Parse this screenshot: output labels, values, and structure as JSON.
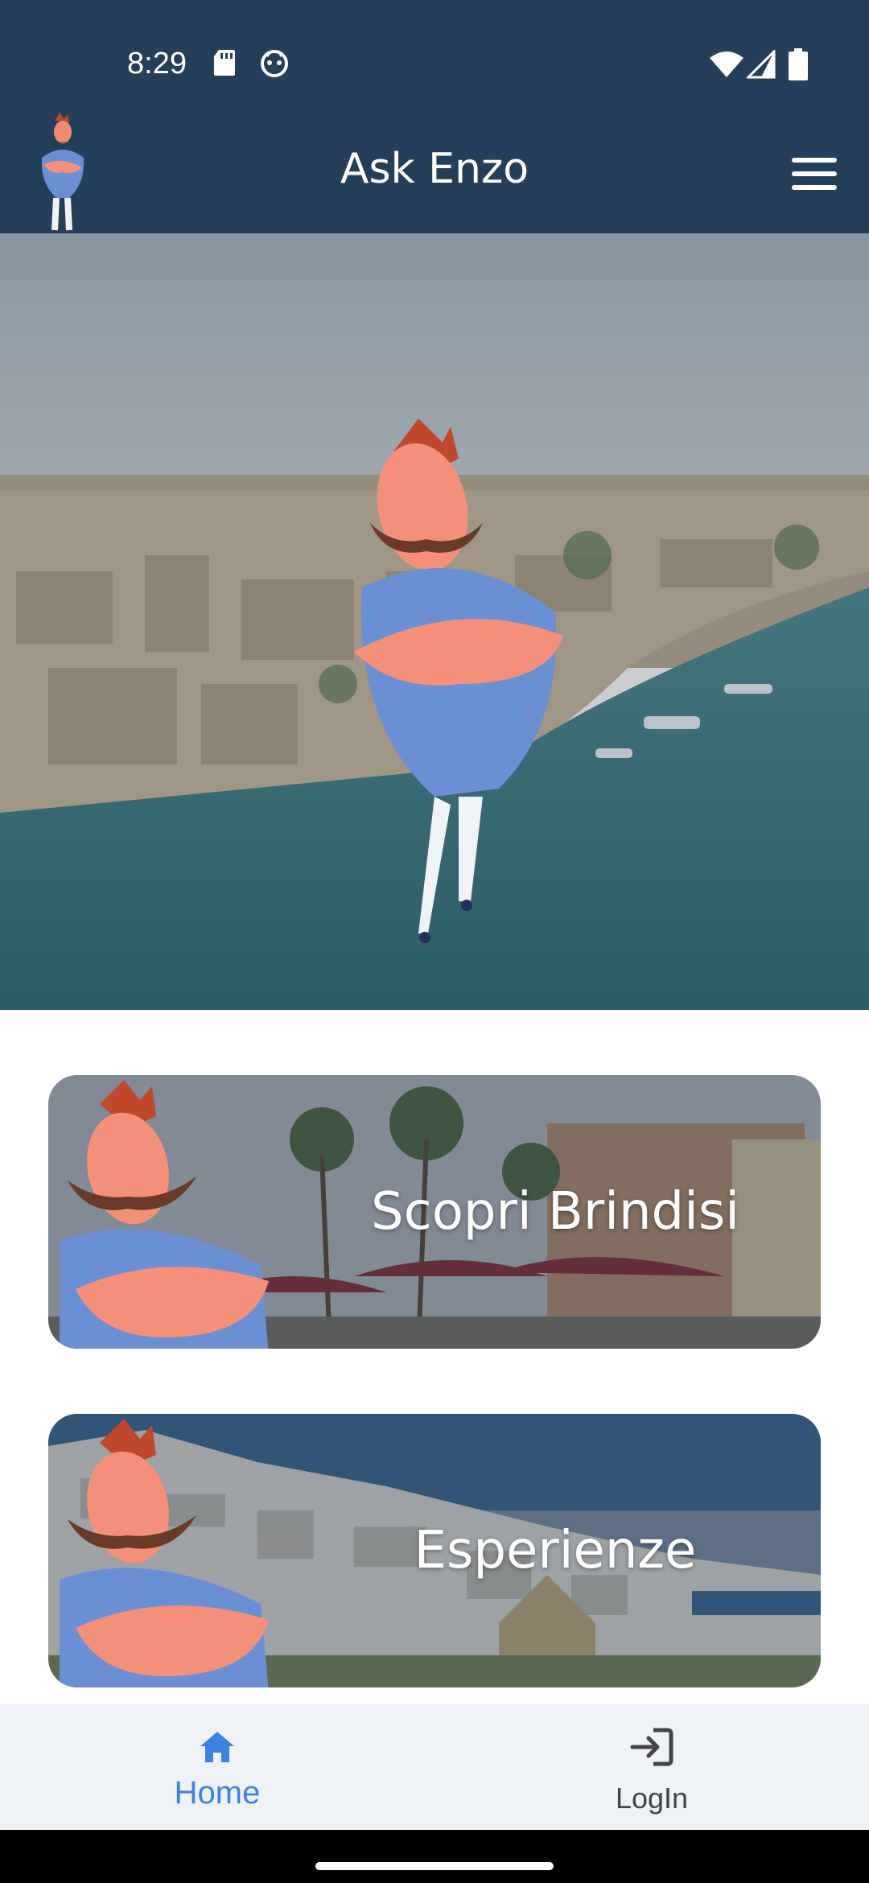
{
  "status_bar": {
    "time": "8:29",
    "icons_left": [
      "sd-card-icon",
      "android-face-icon"
    ],
    "icons_right": [
      "wifi-icon",
      "signal-icon",
      "battery-icon"
    ]
  },
  "app_bar": {
    "title": "Ask Enzo",
    "menu_icon": "hamburger-menu-icon",
    "logo": "enzo-mascot-logo"
  },
  "hero": {
    "image": "brindisi-harbor-with-enzo-mascot"
  },
  "cards": [
    {
      "title": "Scopri Brindisi",
      "image": "brindisi-promenade-palms"
    },
    {
      "title": "Esperienze",
      "image": "white-town-hillside"
    }
  ],
  "bottom_nav": {
    "items": [
      {
        "label": "Home",
        "icon": "home-icon",
        "active": true
      },
      {
        "label": "LogIn",
        "icon": "login-icon",
        "active": false
      }
    ]
  },
  "colors": {
    "primary_dark": "#243f59",
    "accent_blue": "#3d82e0",
    "nav_bg": "#eef2f6"
  }
}
